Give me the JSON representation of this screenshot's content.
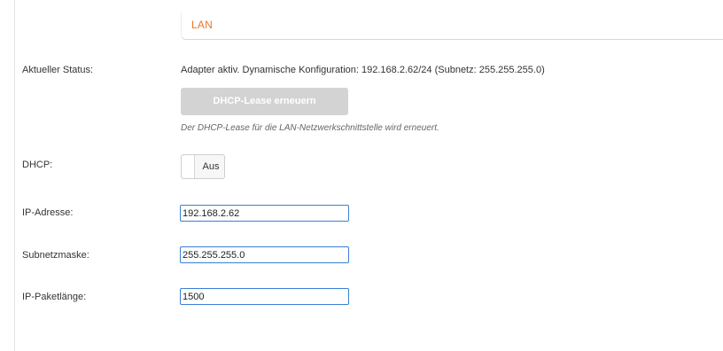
{
  "section": {
    "title": "LAN"
  },
  "status": {
    "label": "Aktueller Status:",
    "text": "Adapter aktiv. Dynamische Konfiguration: 192.168.2.62/24 (Subnetz: 255.255.255.0)",
    "renew_button": "DHCP-Lease erneuern",
    "hint": "Der DHCP-Lease für die LAN-Netzwerkschnittstelle wird erneuert."
  },
  "dhcp": {
    "label": "DHCP:",
    "toggle_value": "Aus",
    "enabled": false
  },
  "ip_address": {
    "label": "IP-Adresse:",
    "value": "192.168.2.62"
  },
  "subnet_mask": {
    "label": "Subnetzmaske:",
    "value": "255.255.255.0"
  },
  "packet_length": {
    "label": "IP-Paketlänge:",
    "value": "1500"
  },
  "colors": {
    "accent": "#e8752a",
    "input_border": "#3a7fd5",
    "disabled_button": "#d3d3d3"
  }
}
